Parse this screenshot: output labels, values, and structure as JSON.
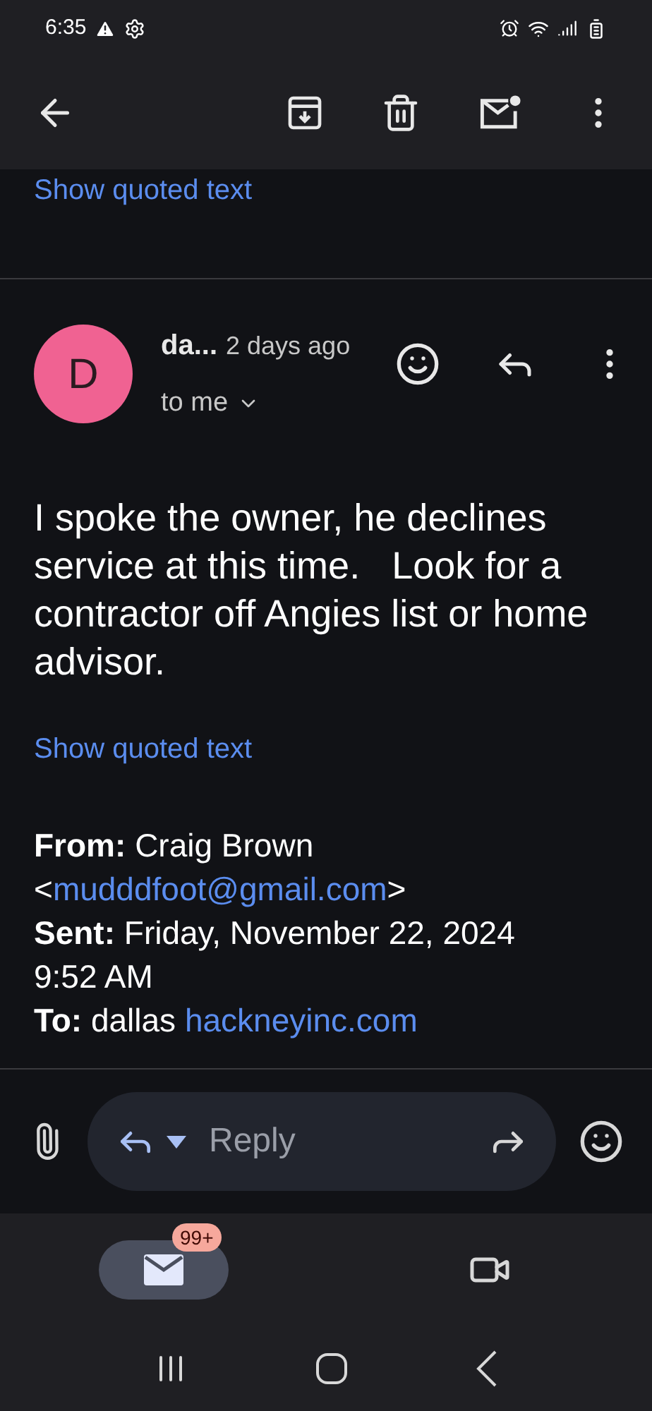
{
  "status_bar": {
    "time": "6:35"
  },
  "previous_message": {
    "show_quoted": "Show quoted text"
  },
  "message": {
    "avatar_letter": "D",
    "sender": "da...",
    "time": "2 days ago",
    "recipient": "to me",
    "body": "I spoke the owner, he declines service at this time.   Look for a contractor off Angies list or home advisor.",
    "show_quoted": "Show quoted text",
    "header_fields": [
      {
        "label": "From:",
        "lines": [
          {
            "text": "Craig Brown"
          },
          {
            "before": "<",
            "link": "mudddfoot@gmail.com",
            "after": ">"
          }
        ]
      },
      {
        "label": "Sent:",
        "lines": [
          {
            "text": "Friday, November 22, 2024"
          },
          {
            "text": "9:52 AM"
          }
        ]
      },
      {
        "label": "To:",
        "lines": [
          {
            "text": "dallas",
            "link": "hackneyinc.com"
          }
        ]
      }
    ]
  },
  "reply_bar": {
    "placeholder": "Reply"
  },
  "bottom_nav": [
    {
      "kind": "mail",
      "selected": true,
      "badge": "99+"
    },
    {
      "kind": "video",
      "selected": false
    }
  ]
}
